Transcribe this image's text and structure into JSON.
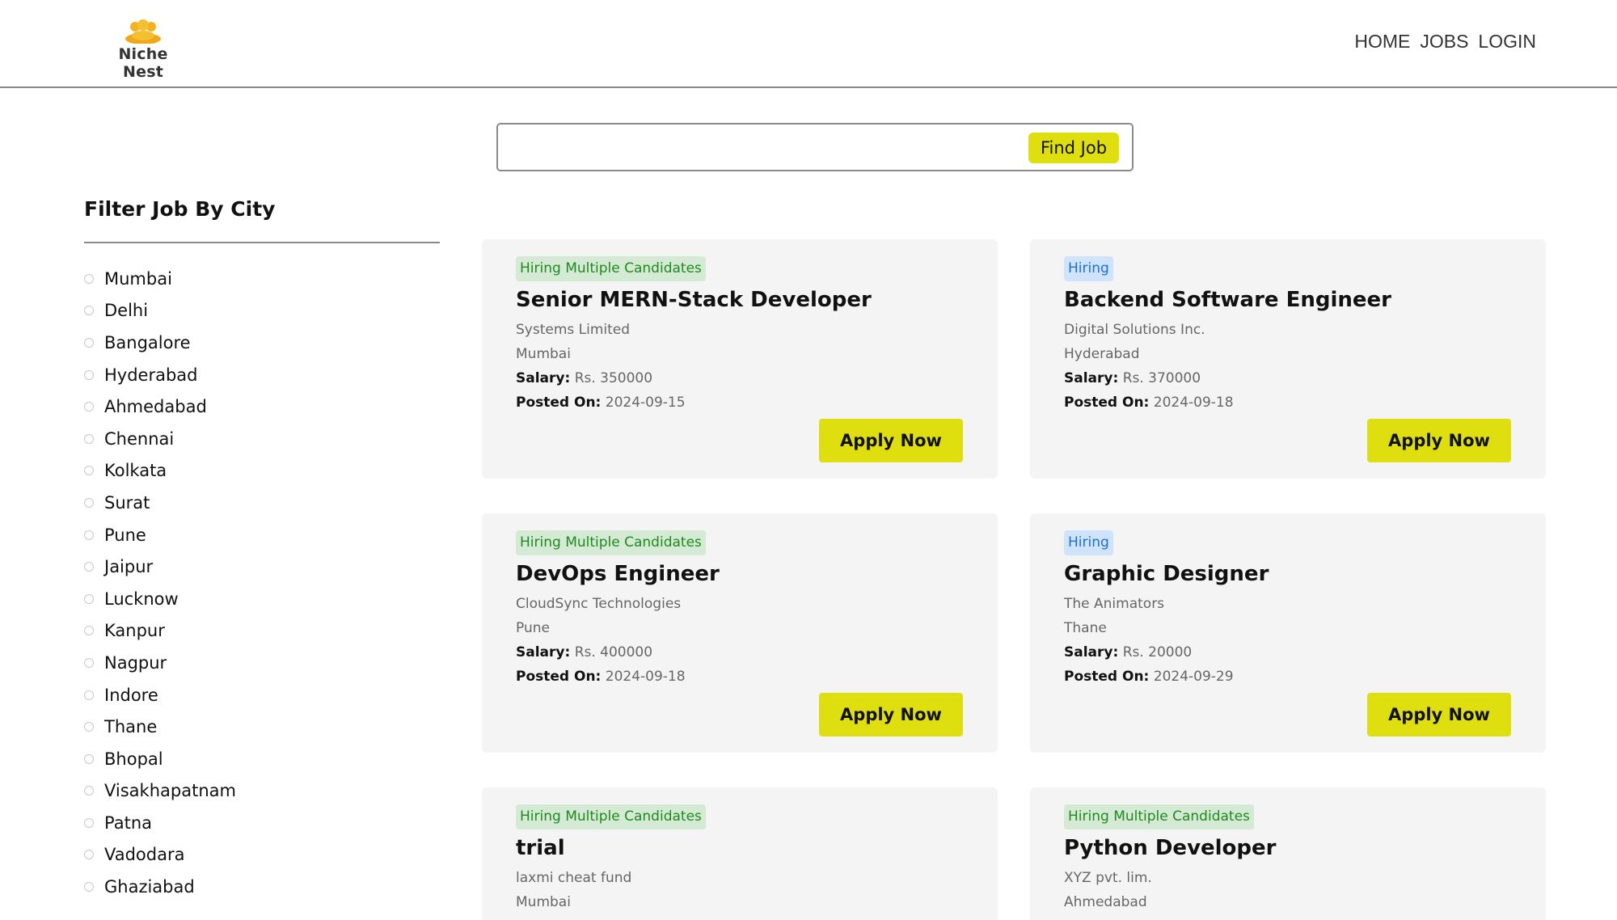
{
  "header": {
    "logo_text": "Niche Nest",
    "nav": [
      "HOME",
      "JOBS",
      "LOGIN"
    ]
  },
  "search": {
    "value": "",
    "button_label": "Find Job"
  },
  "sidebar": {
    "title": "Filter Job By City",
    "cities": [
      "Mumbai",
      "Delhi",
      "Bangalore",
      "Hyderabad",
      "Ahmedabad",
      "Chennai",
      "Kolkata",
      "Surat",
      "Pune",
      "Jaipur",
      "Lucknow",
      "Kanpur",
      "Nagpur",
      "Indore",
      "Thane",
      "Bhopal",
      "Visakhapatnam",
      "Patna",
      "Vadodara",
      "Ghaziabad"
    ]
  },
  "labels": {
    "salary": "Salary:",
    "posted": "Posted On:",
    "apply": "Apply Now"
  },
  "colors": {
    "accent": "#dfdf0f",
    "multi_badge_bg": "#d5ead4",
    "multi_badge_text": "#1f8a1f",
    "single_badge_bg": "#cfe3fb",
    "single_badge_text": "#1d6fd1"
  },
  "jobs": [
    {
      "badge": "Hiring Multiple Candidates",
      "badge_type": "multi",
      "title": "Senior MERN-Stack Developer",
      "company": "Systems Limited",
      "location": "Mumbai",
      "salary": "Rs. 350000",
      "posted": "2024-09-15"
    },
    {
      "badge": "Hiring",
      "badge_type": "single",
      "title": "Backend Software Engineer",
      "company": "Digital Solutions Inc.",
      "location": "Hyderabad",
      "salary": "Rs. 370000",
      "posted": "2024-09-18"
    },
    {
      "badge": "Hiring Multiple Candidates",
      "badge_type": "multi",
      "title": "DevOps Engineer",
      "company": "CloudSync Technologies",
      "location": "Pune",
      "salary": "Rs. 400000",
      "posted": "2024-09-18"
    },
    {
      "badge": "Hiring",
      "badge_type": "single",
      "title": "Graphic Designer",
      "company": "The Animators",
      "location": "Thane",
      "salary": "Rs. 20000",
      "posted": "2024-09-29"
    },
    {
      "badge": "Hiring Multiple Candidates",
      "badge_type": "multi",
      "title": "trial",
      "company": "laxmi cheat fund",
      "location": "Mumbai",
      "salary": "",
      "posted": ""
    },
    {
      "badge": "Hiring Multiple Candidates",
      "badge_type": "multi",
      "title": "Python Developer",
      "company": "XYZ pvt. lim.",
      "location": "Ahmedabad",
      "salary": "",
      "posted": ""
    }
  ]
}
